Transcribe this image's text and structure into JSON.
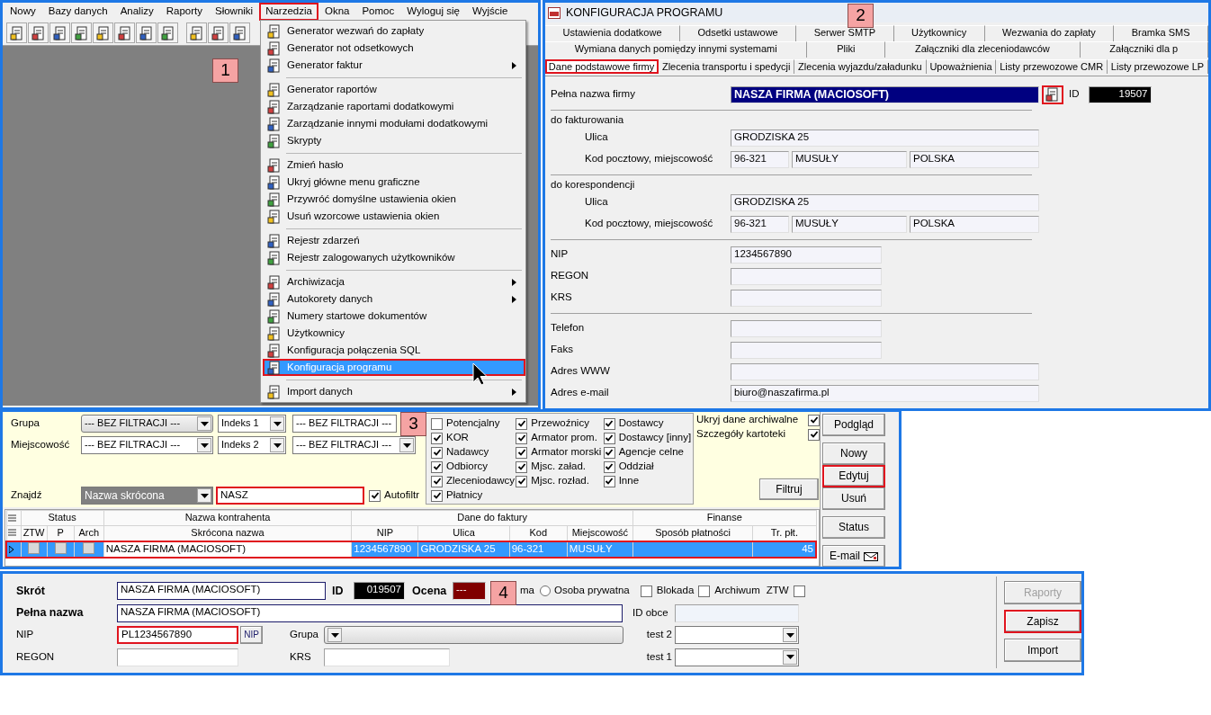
{
  "main_window": {
    "callout": "1",
    "menu_bar": [
      {
        "label": "Nowy",
        "highlighted": false
      },
      {
        "label": "Bazy danych",
        "highlighted": false
      },
      {
        "label": "Analizy",
        "highlighted": false
      },
      {
        "label": "Raporty",
        "highlighted": false
      },
      {
        "label": "Słowniki",
        "highlighted": false
      },
      {
        "label": "Narzedzia",
        "highlighted": true
      },
      {
        "label": "Okna",
        "highlighted": false
      },
      {
        "label": "Pomoc",
        "highlighted": false
      },
      {
        "label": "Wyloguj się",
        "highlighted": false
      },
      {
        "label": "Wyjście",
        "highlighted": false
      }
    ],
    "menu": [
      {
        "kind": "item",
        "label": "Generator wezwań do zapłaty",
        "submenu": false,
        "selected": false,
        "highlighted": false
      },
      {
        "kind": "item",
        "label": "Generator not odsetkowych",
        "submenu": false,
        "selected": false,
        "highlighted": false
      },
      {
        "kind": "item",
        "label": "Generator faktur",
        "submenu": true,
        "selected": false,
        "highlighted": false
      },
      {
        "kind": "separator"
      },
      {
        "kind": "item",
        "label": "Generator raportów",
        "submenu": false,
        "selected": false,
        "highlighted": false
      },
      {
        "kind": "item",
        "label": "Zarządzanie raportami dodatkowymi",
        "submenu": false,
        "selected": false,
        "highlighted": false
      },
      {
        "kind": "item",
        "label": "Zarządzanie innymi modułami dodatkowymi",
        "submenu": false,
        "selected": false,
        "highlighted": false
      },
      {
        "kind": "item",
        "label": "Skrypty",
        "submenu": false,
        "selected": false,
        "highlighted": false
      },
      {
        "kind": "separator"
      },
      {
        "kind": "item",
        "label": "Zmień hasło",
        "submenu": false,
        "selected": false,
        "highlighted": false
      },
      {
        "kind": "item",
        "label": "Ukryj główne menu graficzne",
        "submenu": false,
        "selected": false,
        "highlighted": false
      },
      {
        "kind": "item",
        "label": "Przywróć domyślne ustawienia okien",
        "submenu": false,
        "selected": false,
        "highlighted": false
      },
      {
        "kind": "item",
        "label": "Usuń wzorcowe ustawienia okien",
        "submenu": false,
        "selected": false,
        "highlighted": false
      },
      {
        "kind": "separator"
      },
      {
        "kind": "item",
        "label": "Rejestr zdarzeń",
        "submenu": false,
        "selected": false,
        "highlighted": false
      },
      {
        "kind": "item",
        "label": "Rejestr zalogowanych użytkowników",
        "submenu": false,
        "selected": false,
        "highlighted": false
      },
      {
        "kind": "separator"
      },
      {
        "kind": "item",
        "label": "Archiwizacja",
        "submenu": true,
        "selected": false,
        "highlighted": false
      },
      {
        "kind": "item",
        "label": "Autokorety danych",
        "submenu": true,
        "selected": false,
        "highlighted": false
      },
      {
        "kind": "item",
        "label": "Numery startowe dokumentów",
        "submenu": false,
        "selected": false,
        "highlighted": false
      },
      {
        "kind": "item",
        "label": "Użytkownicy",
        "submenu": false,
        "selected": false,
        "highlighted": false
      },
      {
        "kind": "item",
        "label": "Konfiguracja połączenia SQL",
        "submenu": false,
        "selected": false,
        "highlighted": false
      },
      {
        "kind": "item",
        "label": "Konfiguracja programu",
        "submenu": false,
        "selected": true,
        "highlighted": true
      },
      {
        "kind": "separator"
      },
      {
        "kind": "item",
        "label": "Import danych",
        "submenu": true,
        "selected": false,
        "highlighted": false
      }
    ]
  },
  "config_window": {
    "callout": "2",
    "title": "KONFIGURACJA PROGRAMU",
    "tab_rows": [
      [
        {
          "label": "Ustawienia dodatkowe",
          "selected": false,
          "highlighted": false
        },
        {
          "label": "Odsetki ustawowe",
          "selected": false,
          "highlighted": false
        },
        {
          "label": "Serwer SMTP",
          "selected": false,
          "highlighted": false
        },
        {
          "label": "Użytkownicy",
          "selected": false,
          "highlighted": false
        },
        {
          "label": "Wezwania do zapłaty",
          "selected": false,
          "highlighted": false
        },
        {
          "label": "Bramka SMS",
          "selected": false,
          "highlighted": false
        }
      ],
      [
        {
          "label": "Wymiana danych pomiędzy innymi systemami",
          "selected": false,
          "highlighted": false
        },
        {
          "label": "Pliki",
          "selected": false,
          "highlighted": false
        },
        {
          "label": "Załączniki dla zleceniodawców",
          "selected": false,
          "highlighted": false
        },
        {
          "label": "Załączniki dla p",
          "selected": false,
          "highlighted": false
        }
      ],
      [
        {
          "label": "Dane podstawowe firmy",
          "selected": true,
          "highlighted": true
        },
        {
          "label": "Zlecenia transportu i spedycji",
          "selected": false,
          "highlighted": false
        },
        {
          "label": "Zlecenia wyjazdu/załadunku",
          "selected": false,
          "highlighted": false
        },
        {
          "label": "Upoważnienia",
          "selected": false,
          "highlighted": false
        },
        {
          "label": "Listy przewozowe CMR",
          "selected": false,
          "highlighted": false
        },
        {
          "label": "Listy przewozowe LP",
          "selected": false,
          "highlighted": false
        }
      ]
    ],
    "form": [
      {
        "kind": "name",
        "label": "Pełna nazwa firmy",
        "value": "NASZA FIRMA (MACIOSOFT)",
        "button_highlighted": true,
        "id_label": "ID",
        "id_value": "19507"
      },
      {
        "kind": "rule"
      },
      {
        "kind": "section",
        "label": "do fakturowania"
      },
      {
        "kind": "long",
        "label": "Ulica",
        "value": "GRODZISKA 25",
        "indent": true
      },
      {
        "kind": "postal",
        "label": "Kod pocztowy, miejscowość",
        "values": [
          "96-321",
          "MUSUŁY",
          "POLSKA"
        ]
      },
      {
        "kind": "rule"
      },
      {
        "kind": "section",
        "label": "do korespondencji"
      },
      {
        "kind": "long",
        "label": "Ulica",
        "value": "GRODZISKA 25",
        "indent": true
      },
      {
        "kind": "postal",
        "label": "Kod pocztowy, miejscowość",
        "values": [
          "96-321",
          "MUSUŁY",
          "POLSKA"
        ]
      },
      {
        "kind": "rule"
      },
      {
        "kind": "short",
        "label": "NIP",
        "value": "1234567890"
      },
      {
        "kind": "short",
        "label": "REGON"
      },
      {
        "kind": "short",
        "label": "KRS"
      },
      {
        "kind": "rule"
      },
      {
        "kind": "short",
        "label": "Telefon"
      },
      {
        "kind": "short",
        "label": "Faks"
      },
      {
        "kind": "long",
        "label": "Adres WWW",
        "indent": false
      },
      {
        "kind": "long",
        "label": "Adres e-mail",
        "value": "biuro@naszafirma.pl",
        "indent": false
      }
    ]
  },
  "contractors_window": {
    "callout": "3",
    "filters": [
      {
        "label": "Grupa",
        "combos": [
          "--- BEZ FILTRACJI ---",
          "Indeks 1",
          "--- BEZ FILTRACJI ---"
        ]
      },
      {
        "label": "Miejscowość",
        "combos": [
          "--- BEZ FILTRACJI ---",
          "Indeks 2",
          "--- BEZ FILTRACJI ---"
        ]
      }
    ],
    "search": {
      "label": "Znajdź",
      "mode": "Nazwa skrócona",
      "value": "NASZ",
      "highlighted": true,
      "autofilter": {
        "label": "Autofiltr",
        "checked": true
      }
    },
    "categories": [
      [
        {
          "label": "Potencjalny",
          "checked": false
        },
        {
          "label": "KOR",
          "checked": true
        },
        {
          "label": "Nadawcy",
          "checked": true
        },
        {
          "label": "Odbiorcy",
          "checked": true
        },
        {
          "label": "Zleceniodawcy",
          "checked": true
        },
        {
          "label": "Płatnicy",
          "checked": true
        }
      ],
      [
        {
          "label": "Przewoźnicy",
          "checked": true
        },
        {
          "label": "Armator prom.",
          "checked": true
        },
        {
          "label": "Armator morski",
          "checked": true
        },
        {
          "label": "Mjsc. załad.",
          "checked": true
        },
        {
          "label": "Mjsc. rozład.",
          "checked": true
        }
      ],
      [
        {
          "label": "Dostawcy",
          "checked": true
        },
        {
          "label": "Dostawcy [inny]",
          "checked": true
        },
        {
          "label": "Agencje celne",
          "checked": true
        },
        {
          "label": "Oddział",
          "checked": true
        },
        {
          "label": "Inne",
          "checked": true
        }
      ]
    ],
    "options": [
      {
        "label": "Ukryj dane archiwalne",
        "checked": true
      },
      {
        "label": "Szczegóły kartoteki",
        "checked": true
      }
    ],
    "filter_button": "Filtruj",
    "button_groups": [
      [
        {
          "label": "Podgląd",
          "kind": "plain",
          "highlighted": false
        }
      ],
      [
        {
          "label": "Nowy",
          "kind": "plain",
          "highlighted": false
        },
        {
          "label": "Edytuj",
          "kind": "plain",
          "highlighted": true
        },
        {
          "label": "Usuń",
          "kind": "plain",
          "highlighted": false
        }
      ],
      [
        {
          "label": "Status",
          "kind": "plain",
          "highlighted": false
        }
      ],
      [
        {
          "label": "E-mail",
          "kind": "mail",
          "highlighted": false
        }
      ]
    ],
    "grid": {
      "groups": [
        "Status",
        "Nazwa kontrahenta",
        "Dane do faktury",
        "Finanse"
      ],
      "flag_columns": [
        "ZTW",
        "P",
        "Arch"
      ],
      "columns": [
        "Skrócona nazwa",
        "NIP",
        "Ulica",
        "Kod",
        "Miejscowość",
        "Sposób płatności",
        "Tr. płt."
      ],
      "rows": [
        {
          "selected": true,
          "highlighted": true,
          "flags": [
            false,
            false,
            false
          ],
          "cells": [
            "NASZA FIRMA (MACIOSOFT)",
            "1234567890",
            "GRODZISKA 25",
            "96-321",
            "MUSUŁY",
            null,
            "45"
          ]
        }
      ]
    }
  },
  "contractor_form": {
    "callout": "4",
    "short_name": {
      "label": "Skrót",
      "value": "NASZA FIRMA (MACIOSOFT)"
    },
    "id": {
      "label": "ID",
      "value": "019507"
    },
    "rating": {
      "label": "Ocena",
      "value": "---"
    },
    "partial_label": "ma",
    "private_radio": {
      "label": "Osoba prywatna",
      "selected": false
    },
    "flags": [
      {
        "label": "Blokada",
        "checked": false,
        "kind": "box-left"
      },
      {
        "label": "Archiwum",
        "checked": false,
        "kind": "box-left"
      },
      {
        "label": "ZTW",
        "checked": false,
        "kind": "box-right"
      }
    ],
    "full_name": {
      "label": "Pełna nazwa",
      "value": "NASZA FIRMA (MACIOSOFT)"
    },
    "foreign_id": {
      "label": "ID obce"
    },
    "nip": {
      "label": "NIP",
      "value": "PL1234567890",
      "highlighted": true,
      "button": "NIP"
    },
    "group": {
      "label": "Grupa"
    },
    "test2": {
      "label": "test 2"
    },
    "regon": {
      "label": "REGON"
    },
    "krs": {
      "label": "KRS"
    },
    "test1": {
      "label": "test 1"
    },
    "buttons": [
      {
        "label": "Raporty",
        "disabled": true,
        "highlighted": false
      },
      {
        "label": "Zapisz",
        "disabled": false,
        "highlighted": true
      },
      {
        "label": "Import",
        "disabled": false,
        "highlighted": false
      }
    ]
  }
}
